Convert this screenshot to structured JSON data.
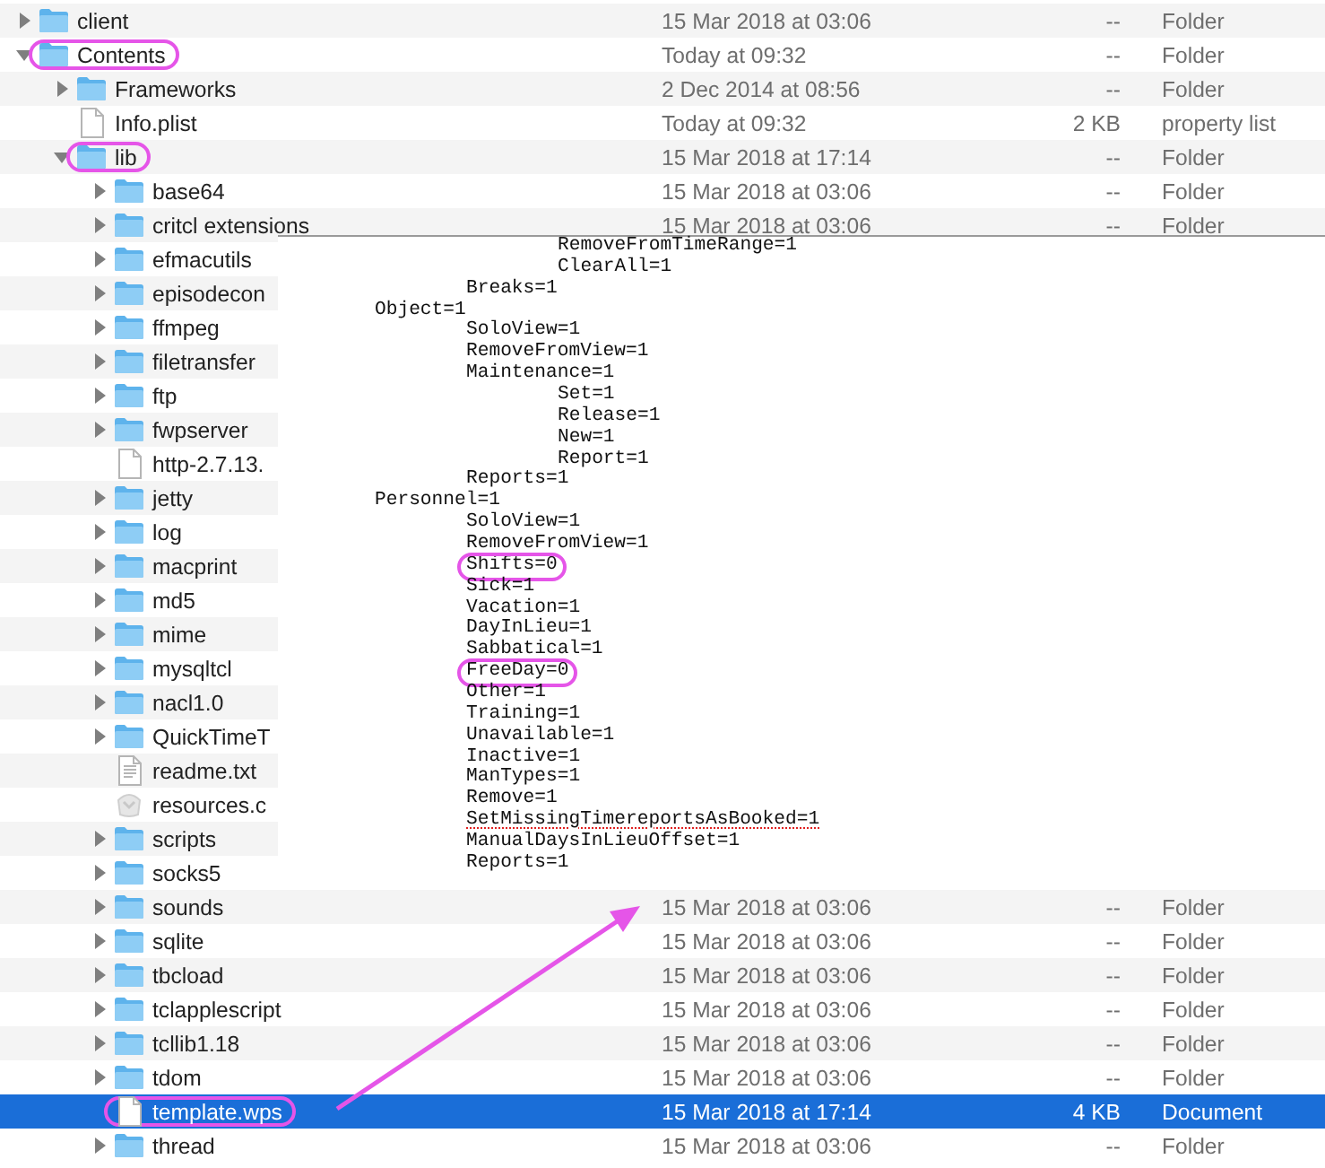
{
  "file_list": {
    "rows": [
      {
        "name": "client",
        "kind": "folder",
        "expanded": false,
        "selected": false,
        "highlighted": false,
        "date_modified": "15 Mar 2018 at 03:06",
        "size": "--",
        "type": "Folder"
      },
      {
        "name": "Contents",
        "kind": "folder",
        "expanded": true,
        "selected": false,
        "highlighted": true,
        "date_modified": "Today at 09:32",
        "size": "--",
        "type": "Folder",
        "children": [
          {
            "name": "Frameworks",
            "kind": "folder",
            "expanded": false,
            "selected": false,
            "highlighted": false,
            "date_modified": "2 Dec 2014 at 08:56",
            "size": "--",
            "type": "Folder"
          },
          {
            "name": "Info.plist",
            "kind": "document",
            "selected": false,
            "highlighted": false,
            "date_modified": "Today at 09:32",
            "size": "2 KB",
            "type": "property list"
          },
          {
            "name": "lib",
            "kind": "folder",
            "expanded": true,
            "selected": false,
            "highlighted": true,
            "date_modified": "15 Mar 2018 at 17:14",
            "size": "--",
            "type": "Folder",
            "children": [
              {
                "name": "base64",
                "kind": "folder",
                "expanded": false,
                "selected": false,
                "highlighted": false,
                "date_modified": "15 Mar 2018 at 03:06",
                "size": "--",
                "type": "Folder"
              },
              {
                "name": "critcl extensions",
                "kind": "folder",
                "expanded": false,
                "selected": false,
                "highlighted": false,
                "date_modified": "15 Mar 2018 at 03:06",
                "size": "--",
                "type": "Folder"
              },
              {
                "name": "efmacutils",
                "kind": "folder",
                "expanded": false,
                "selected": false,
                "highlighted": false
              },
              {
                "name": "episodecon",
                "kind": "folder",
                "expanded": false,
                "selected": false,
                "highlighted": false
              },
              {
                "name": "ffmpeg",
                "kind": "folder",
                "expanded": false,
                "selected": false,
                "highlighted": false
              },
              {
                "name": "filetransfer",
                "kind": "folder",
                "expanded": false,
                "selected": false,
                "highlighted": false
              },
              {
                "name": "ftp",
                "kind": "folder",
                "expanded": false,
                "selected": false,
                "highlighted": false
              },
              {
                "name": "fwpserver",
                "kind": "folder",
                "expanded": false,
                "selected": false,
                "highlighted": false
              },
              {
                "name": "http-2.7.13.",
                "kind": "document",
                "selected": false,
                "highlighted": false
              },
              {
                "name": "jetty",
                "kind": "folder",
                "expanded": false,
                "selected": false,
                "highlighted": false
              },
              {
                "name": "log",
                "kind": "folder",
                "expanded": false,
                "selected": false,
                "highlighted": false
              },
              {
                "name": "macprint",
                "kind": "folder",
                "expanded": false,
                "selected": false,
                "highlighted": false
              },
              {
                "name": "md5",
                "kind": "folder",
                "expanded": false,
                "selected": false,
                "highlighted": false
              },
              {
                "name": "mime",
                "kind": "folder",
                "expanded": false,
                "selected": false,
                "highlighted": false
              },
              {
                "name": "mysqltcl",
                "kind": "folder",
                "expanded": false,
                "selected": false,
                "highlighted": false
              },
              {
                "name": "nacl1.0",
                "kind": "folder",
                "expanded": false,
                "selected": false,
                "highlighted": false
              },
              {
                "name": "QuickTimeT",
                "kind": "folder",
                "expanded": false,
                "selected": false,
                "highlighted": false
              },
              {
                "name": "readme.txt",
                "kind": "text-document",
                "selected": false,
                "highlighted": false
              },
              {
                "name": "resources.c",
                "kind": "bundle",
                "selected": false,
                "highlighted": false
              },
              {
                "name": "scripts",
                "kind": "folder",
                "expanded": false,
                "selected": false,
                "highlighted": false
              },
              {
                "name": "socks5",
                "kind": "folder",
                "expanded": false,
                "selected": false,
                "highlighted": false
              },
              {
                "name": "sounds",
                "kind": "folder",
                "expanded": false,
                "selected": false,
                "highlighted": false,
                "date_modified": "15 Mar 2018 at 03:06",
                "size": "--",
                "type": "Folder"
              },
              {
                "name": "sqlite",
                "kind": "folder",
                "expanded": false,
                "selected": false,
                "highlighted": false,
                "date_modified": "15 Mar 2018 at 03:06",
                "size": "--",
                "type": "Folder"
              },
              {
                "name": "tbcload",
                "kind": "folder",
                "expanded": false,
                "selected": false,
                "highlighted": false,
                "date_modified": "15 Mar 2018 at 03:06",
                "size": "--",
                "type": "Folder"
              },
              {
                "name": "tclapplescript",
                "kind": "folder",
                "expanded": false,
                "selected": false,
                "highlighted": false,
                "date_modified": "15 Mar 2018 at 03:06",
                "size": "--",
                "type": "Folder"
              },
              {
                "name": "tcllib1.18",
                "kind": "folder",
                "expanded": false,
                "selected": false,
                "highlighted": false,
                "date_modified": "15 Mar 2018 at 03:06",
                "size": "--",
                "type": "Folder"
              },
              {
                "name": "tdom",
                "kind": "folder",
                "expanded": false,
                "selected": false,
                "highlighted": false,
                "date_modified": "15 Mar 2018 at 03:06",
                "size": "--",
                "type": "Folder"
              },
              {
                "name": "template.wps",
                "kind": "document",
                "selected": true,
                "highlighted": true,
                "date_modified": "15 Mar 2018 at 17:14",
                "size": "4 KB",
                "type": "Document"
              },
              {
                "name": "thread",
                "kind": "folder",
                "expanded": false,
                "selected": false,
                "highlighted": false,
                "date_modified": "15 Mar 2018 at 03:06",
                "size": "--",
                "type": "Folder"
              }
            ]
          }
        ]
      }
    ]
  },
  "text_overlay": {
    "lines": [
      {
        "text": "\t\tRemoveFromTimeRange=1",
        "highlighted": false,
        "misspelled": false
      },
      {
        "text": "\t\tClearAll=1",
        "highlighted": false,
        "misspelled": false
      },
      {
        "text": "\tBreaks=1",
        "highlighted": false,
        "misspelled": false
      },
      {
        "text": "Object=1",
        "highlighted": false,
        "misspelled": false
      },
      {
        "text": "\tSoloView=1",
        "highlighted": false,
        "misspelled": false
      },
      {
        "text": "\tRemoveFromView=1",
        "highlighted": false,
        "misspelled": false
      },
      {
        "text": "\tMaintenance=1",
        "highlighted": false,
        "misspelled": false
      },
      {
        "text": "\t\tSet=1",
        "highlighted": false,
        "misspelled": false
      },
      {
        "text": "\t\tRelease=1",
        "highlighted": false,
        "misspelled": false
      },
      {
        "text": "\t\tNew=1",
        "highlighted": false,
        "misspelled": false
      },
      {
        "text": "\t\tReport=1",
        "highlighted": false,
        "misspelled": false
      },
      {
        "text": "\tReports=1",
        "highlighted": false,
        "misspelled": false
      },
      {
        "text": "Personnel=1",
        "highlighted": false,
        "misspelled": false
      },
      {
        "text": "\tSoloView=1",
        "highlighted": false,
        "misspelled": false
      },
      {
        "text": "\tRemoveFromView=1",
        "highlighted": false,
        "misspelled": false
      },
      {
        "text": "\tShifts=0",
        "highlighted": true,
        "misspelled": false
      },
      {
        "text": "\tSick=1",
        "highlighted": false,
        "misspelled": false
      },
      {
        "text": "\tVacation=1",
        "highlighted": false,
        "misspelled": false
      },
      {
        "text": "\tDayInLieu=1",
        "highlighted": false,
        "misspelled": false
      },
      {
        "text": "\tSabbatical=1",
        "highlighted": false,
        "misspelled": false
      },
      {
        "text": "\tFreeDay=0",
        "highlighted": true,
        "misspelled": false
      },
      {
        "text": "\tOther=1",
        "highlighted": false,
        "misspelled": false
      },
      {
        "text": "\tTraining=1",
        "highlighted": false,
        "misspelled": false
      },
      {
        "text": "\tUnavailable=1",
        "highlighted": false,
        "misspelled": false
      },
      {
        "text": "\tInactive=1",
        "highlighted": false,
        "misspelled": false
      },
      {
        "text": "\tManTypes=1",
        "highlighted": false,
        "misspelled": false
      },
      {
        "text": "\tRemove=1",
        "highlighted": false,
        "misspelled": false
      },
      {
        "text": "\tSetMissingTimereportsAsBooked=1",
        "highlighted": false,
        "misspelled": true
      },
      {
        "text": "\tManualDaysInLieuOffset=1",
        "highlighted": false,
        "misspelled": false
      },
      {
        "text": "\tReports=1",
        "highlighted": false,
        "misspelled": false
      }
    ]
  },
  "annotation": {
    "arrow": true
  }
}
